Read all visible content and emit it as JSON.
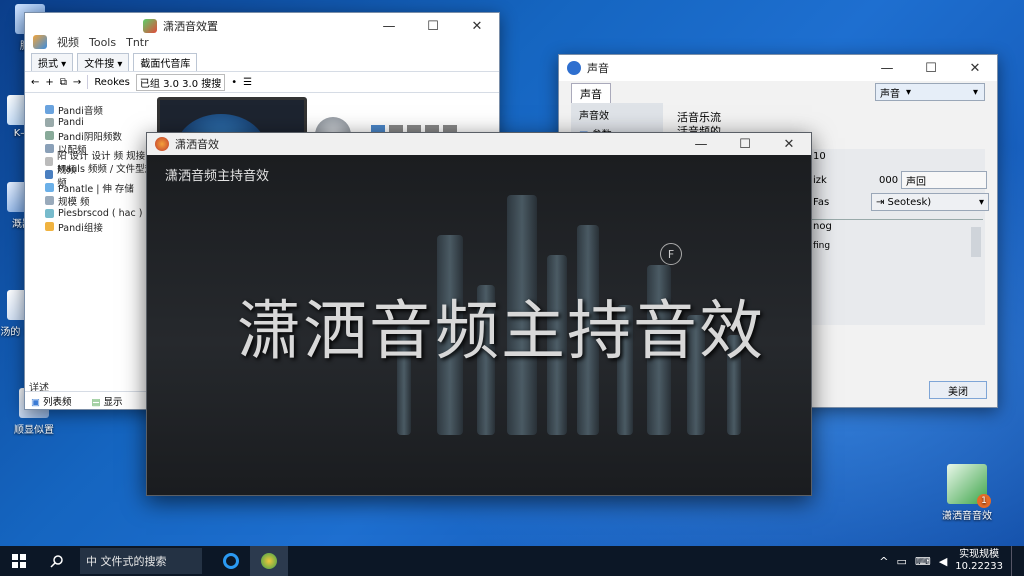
{
  "desktop": {
    "icons": [
      {
        "label": "脑版"
      },
      {
        "label": "K—"
      },
      {
        "label": "溉器"
      },
      {
        "label": "汤的 以的"
      },
      {
        "label": "顺显似置"
      }
    ],
    "shortcut": {
      "label": "潇洒音音效",
      "badge": "1"
    }
  },
  "explorer": {
    "title": "潇洒音效置",
    "menu": [
      "视频",
      "Tools",
      "Tntr"
    ],
    "tabs": [
      "损式 ▾",
      "文件搜 ▾",
      "截面代音库"
    ],
    "toolbar": [
      "Reokes",
      "已组 3.0 3.0 搜搜",
      "•"
    ],
    "tree": [
      "Pandi音频",
      "Pandi",
      "Pandi阴阳频数",
      "以配频",
      "阳 设计 设计 频 规接 规频",
      "Mauls 频频 / 文件型规频",
      "Panatle | 伸 存储",
      "规模 频",
      "Piesbrscod ( hac )",
      "Pandi组接"
    ],
    "bottom_label": "详述",
    "status": [
      "列表频",
      "显示"
    ]
  },
  "player": {
    "title": "潇洒音效",
    "small_caption": "潇洒音频主持音效",
    "caption": "潇洒音频主持音效",
    "badge": "F"
  },
  "sound": {
    "title": "声音",
    "tab": "声音",
    "dropdown_value": "声音",
    "sidebar": [
      "声音效",
      "参数"
    ],
    "heading": "活音乐流",
    "subheading": "活音频的",
    "value_10": "10",
    "label_izk": "izk",
    "value_000": "000",
    "field_1": "声回",
    "label_fas": "Fas",
    "select_2": "⇥ Seotesk)",
    "label_nog": "nog",
    "label_fing": "fing",
    "ok_button": "美闭"
  },
  "taskbar": {
    "search_text": "中 文件式的搜索",
    "clock_line1": "实现规模",
    "clock_line2": "10.22233"
  }
}
